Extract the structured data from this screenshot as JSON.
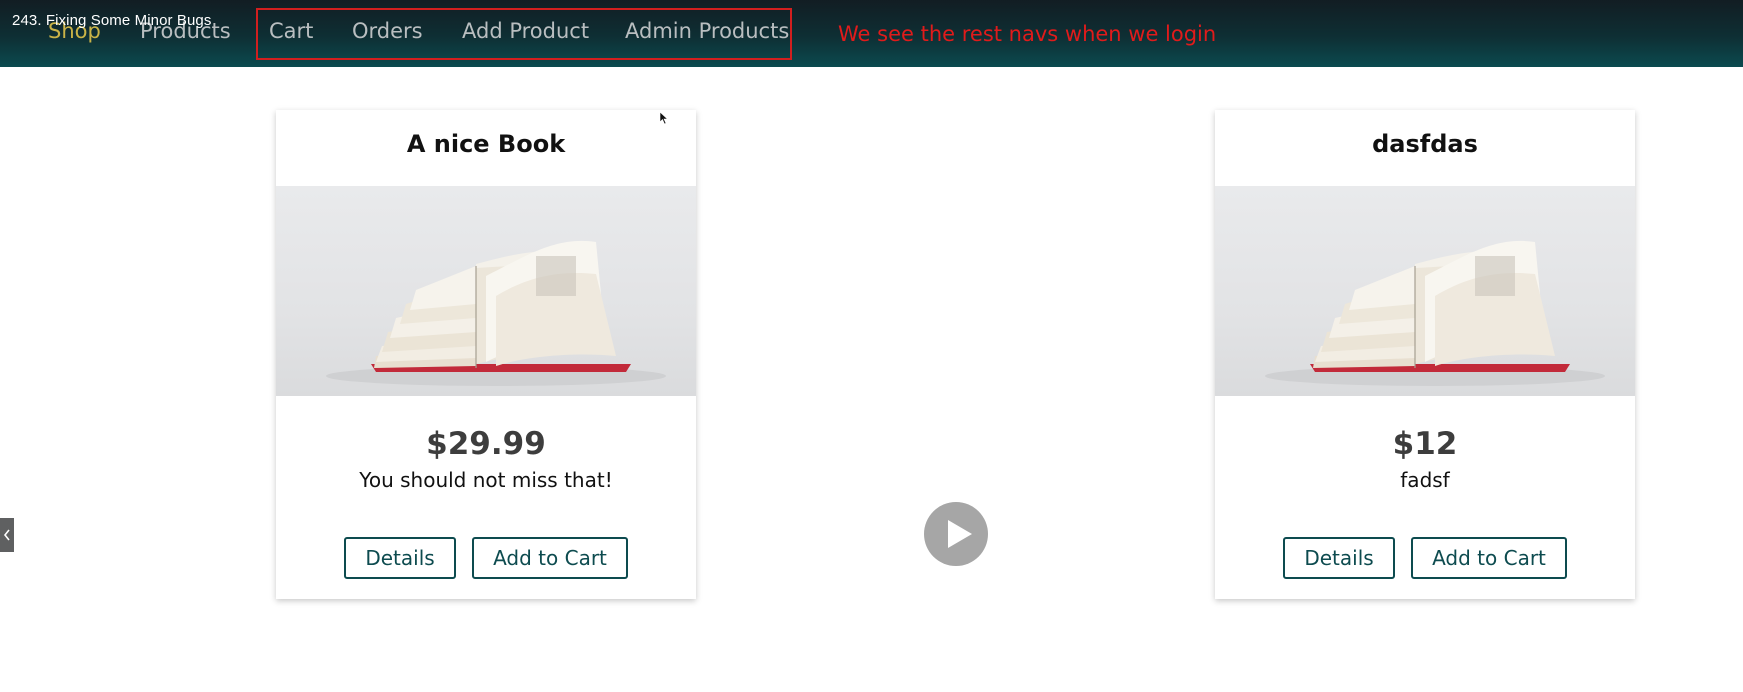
{
  "video": {
    "title": "243. Fixing Some Minor Bugs"
  },
  "nav": {
    "items": [
      {
        "label": "Shop",
        "active": true
      },
      {
        "label": "Products",
        "active": false
      },
      {
        "label": "Cart",
        "active": false
      },
      {
        "label": "Orders",
        "active": false
      },
      {
        "label": "Add Product",
        "active": false
      },
      {
        "label": "Admin Products",
        "active": false
      }
    ]
  },
  "annotation": {
    "text": "We see the rest navs when we login",
    "color": "#e01b1b"
  },
  "products": [
    {
      "title": "A nice Book",
      "price": "$29.99",
      "description": "You should not miss that!",
      "details_label": "Details",
      "add_to_cart_label": "Add to Cart"
    },
    {
      "title": "dasfdas",
      "price": "$12",
      "description": "fadsf",
      "details_label": "Details",
      "add_to_cart_label": "Add to Cart"
    }
  ],
  "icons": {
    "play": "play-icon",
    "chevron": "chevron-left-icon",
    "cursor": "mouse-cursor-icon"
  },
  "colors": {
    "header": "#0e2f34",
    "active_nav": "#c9b347",
    "nav": "#b9bec0",
    "highlight": "#d11f1f",
    "button": "#0d4b4f"
  }
}
